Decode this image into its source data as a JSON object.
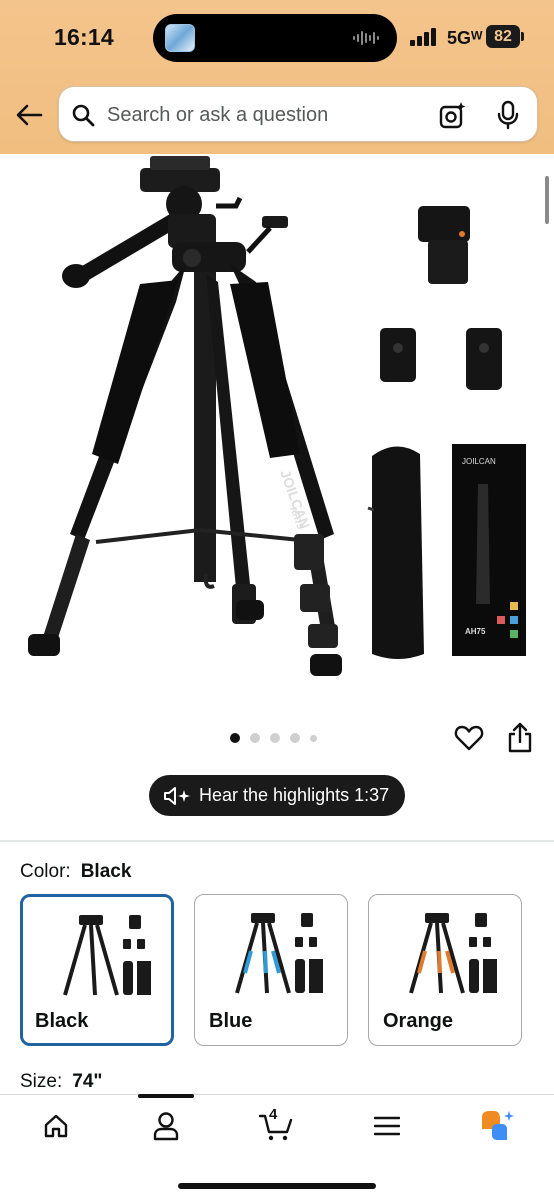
{
  "status_bar": {
    "time": "16:14",
    "network": "5Gᵂ",
    "battery": "82"
  },
  "search": {
    "placeholder": "Search or ask a question"
  },
  "product": {
    "brand_on_box": "JOILCAN",
    "model_on_box": "AH75",
    "leg_label_brand": "JOILCAN",
    "leg_label_model": "AH75",
    "image_count": 5,
    "active_image": 1
  },
  "highlights": {
    "label": "Hear the highlights 1:37"
  },
  "variations": {
    "color_label": "Color:",
    "color_value": "Black",
    "size_label": "Size:",
    "size_value": "74\"",
    "options": [
      {
        "label": "Black",
        "accent": "#1a1a1a",
        "selected": true
      },
      {
        "label": "Blue",
        "accent": "#2f9bd6",
        "selected": false
      },
      {
        "label": "Orange",
        "accent": "#e07a2e",
        "selected": false
      }
    ]
  },
  "bottom_nav": {
    "cart_count": "4",
    "items": [
      "home",
      "account",
      "cart",
      "menu",
      "rufus"
    ]
  },
  "colors": {
    "header": "#f3c48c",
    "selected_border": "#2162a1",
    "pill_bg": "#1a1a1a"
  }
}
